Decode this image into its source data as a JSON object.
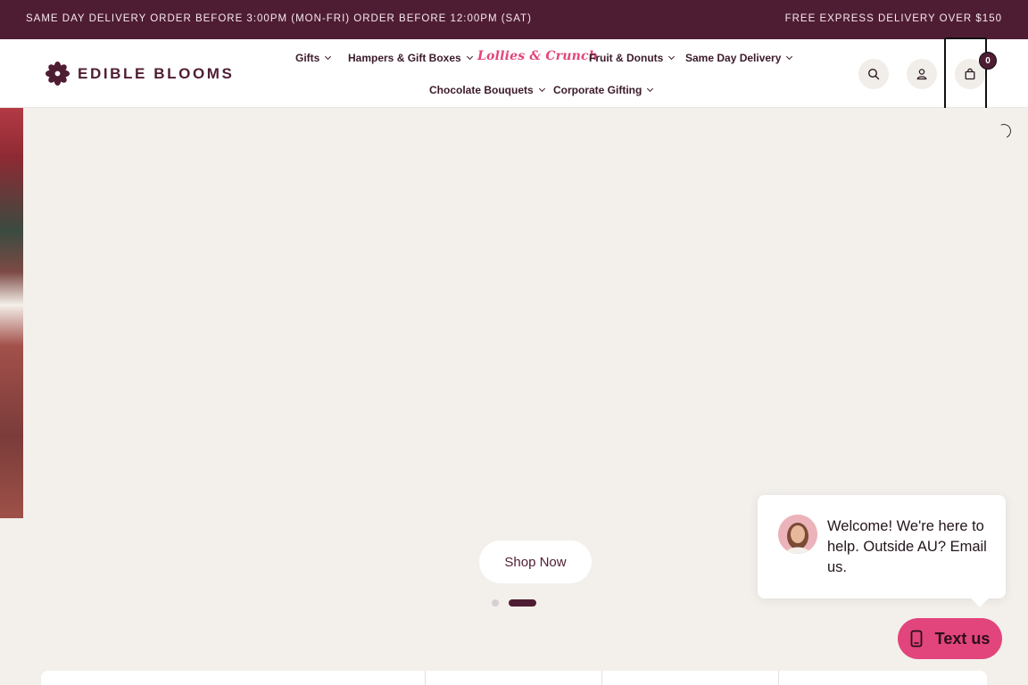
{
  "announcement": {
    "left": "SAME DAY DELIVERY ORDER BEFORE 3:00PM (MON-FRI) ORDER BEFORE 12:00PM (SAT)",
    "right": "FREE EXPRESS DELIVERY OVER $150"
  },
  "brand": {
    "name": "EDIBLE BLOOMS"
  },
  "nav": {
    "gifts": "Gifts",
    "hampers": "Hampers & Gift Boxes",
    "lollies": "Lollies & Crunch",
    "fruit": "Fruit & Donuts",
    "same_day": "Same Day Delivery",
    "chocolate": "Chocolate Bouquets",
    "corporate": "Corporate Gifting"
  },
  "cart": {
    "count": "0"
  },
  "hero": {
    "cta": "Shop Now",
    "slides_total": 2,
    "active_slide": 2
  },
  "chat": {
    "message": "Welcome! We're here to help. Outside AU? Email us.",
    "button": "Text us"
  },
  "colors": {
    "brand": "#4f1d33",
    "accent_pink": "#e1457b",
    "hero_bg": "#f3f0ec"
  },
  "icons": [
    "search-icon",
    "account-icon",
    "bag-icon",
    "chevron-down-icon",
    "loading-spinner-icon",
    "phone-icon"
  ]
}
